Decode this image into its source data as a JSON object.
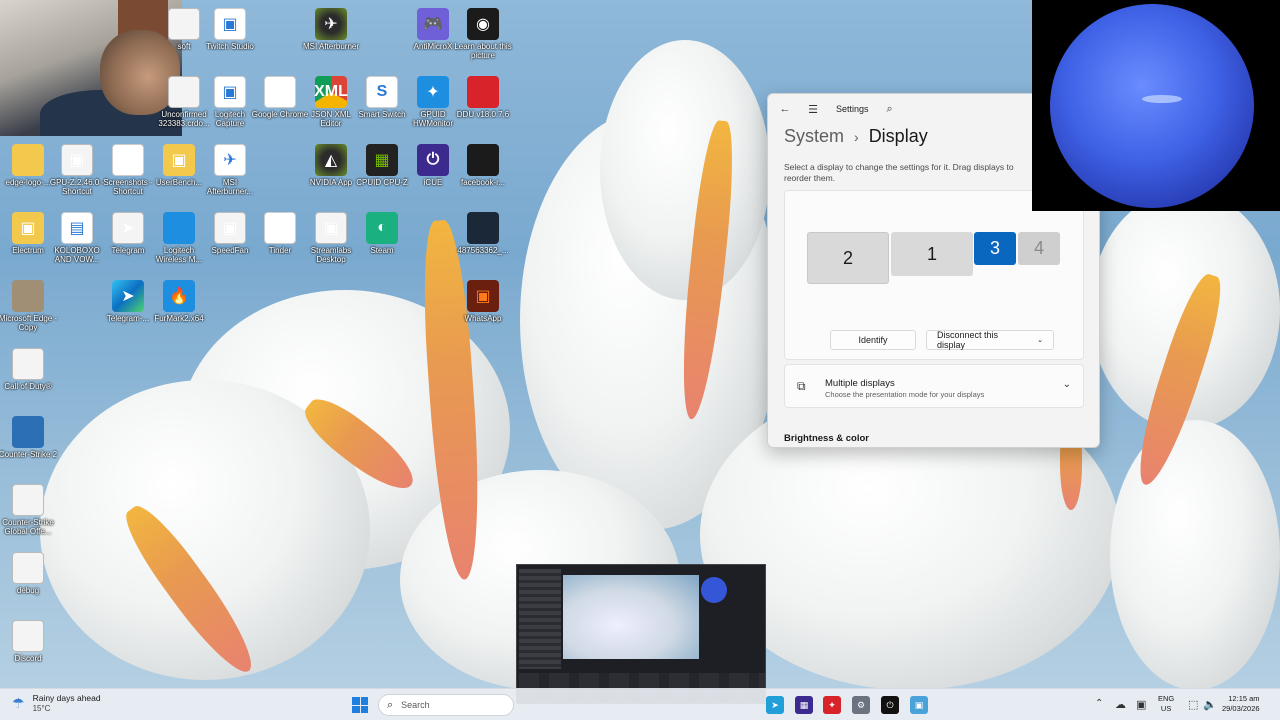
{
  "desktop_icons": [
    {
      "label": "soft",
      "glyph": "",
      "name": "icon-soft"
    },
    {
      "label": "Twitch Studio",
      "glyph": "▣",
      "name": "icon-twitch-studio"
    },
    {
      "label": "MSI Afterburner",
      "glyph": "✈",
      "name": "icon-msi-afterburner"
    },
    {
      "label": "AntiMicroX",
      "glyph": "🎮",
      "name": "icon-antimicrox"
    },
    {
      "label": "Learn about this picture",
      "glyph": "◉",
      "name": "icon-learn-about-picture"
    },
    {
      "label": "Unconfirmed 323383.crdo...",
      "glyph": "",
      "name": "icon-unconfirmed-download"
    },
    {
      "label": "Logitech Capture",
      "glyph": "▣",
      "name": "icon-logitech-capture"
    },
    {
      "label": "Google Chrome",
      "glyph": "",
      "name": "icon-google-chrome"
    },
    {
      "label": "JSON XML Editor",
      "glyph": "XML",
      "name": "icon-json-xml-editor"
    },
    {
      "label": "Smart Switch",
      "glyph": "S",
      "name": "icon-smart-switch"
    },
    {
      "label": "GPUID HWMonitor",
      "glyph": "✦",
      "name": "icon-hwmonitor"
    },
    {
      "label": "DDU v18.0.7.6",
      "glyph": "",
      "name": "icon-ddu"
    },
    {
      "label": "edge-logo-...",
      "glyph": "",
      "name": "icon-edge-logo"
    },
    {
      "label": "GPU-Z.2.46.0 - Shortcut",
      "glyph": "▣",
      "name": "icon-gpuz"
    },
    {
      "label": "Screenshots - Shortcut",
      "glyph": "",
      "name": "icon-screenshots"
    },
    {
      "label": "UserBench...",
      "glyph": "▣",
      "name": "icon-userbench"
    },
    {
      "label": "MSI Afterburner...",
      "glyph": "✈",
      "name": "icon-msi-afterburner-2"
    },
    {
      "label": "NVIDIA App",
      "glyph": "◭",
      "name": "icon-nvidia-app"
    },
    {
      "label": "CPUID CPU-Z",
      "glyph": "▦",
      "name": "icon-cpuz"
    },
    {
      "label": "iCUE",
      "glyph": "⏻",
      "name": "icon-icue"
    },
    {
      "label": "facebook-r...",
      "glyph": "",
      "name": "icon-facebook-folder"
    },
    {
      "label": "Electrum",
      "glyph": "▣",
      "name": "icon-electrum"
    },
    {
      "label": "KOLOBOXO AND VOW...",
      "glyph": "▤",
      "name": "icon-koloboxo"
    },
    {
      "label": "Telegram",
      "glyph": "➤",
      "name": "icon-telegram"
    },
    {
      "label": "Logitech Wireless M...",
      "glyph": "",
      "name": "icon-logitech-wireless"
    },
    {
      "label": "SpeedFan",
      "glyph": "▣",
      "name": "icon-speedfan"
    },
    {
      "label": "Tinder",
      "glyph": "",
      "name": "icon-tinder"
    },
    {
      "label": "Streamlabs Desktop",
      "glyph": "▣",
      "name": "icon-streamlabs"
    },
    {
      "label": "Steam",
      "glyph": "◐",
      "name": "icon-steam"
    },
    {
      "label": "487563362_...",
      "glyph": "",
      "name": "icon-image-file"
    },
    {
      "label": "Microsoft Edge - Copy",
      "glyph": "",
      "name": "icon-edge-copy"
    },
    {
      "label": "Telegram-...",
      "glyph": "➤",
      "name": "icon-telegram-2"
    },
    {
      "label": "FurMark2.x64",
      "glyph": "🔥",
      "name": "icon-furmark"
    },
    {
      "label": "WhatsApp",
      "glyph": "▣",
      "name": "icon-whatsapp"
    },
    {
      "label": "Call of Duty®",
      "glyph": "",
      "name": "icon-call-of-duty"
    },
    {
      "label": "Counter-Strike 2",
      "glyph": "",
      "name": "icon-cs2"
    },
    {
      "label": "Counter-Strike Global Offe...",
      "glyph": "",
      "name": "icon-csgo"
    },
    {
      "label": "debug",
      "glyph": "",
      "name": "icon-debug"
    },
    {
      "label": "Discord",
      "glyph": "",
      "name": "icon-discord"
    }
  ],
  "settings": {
    "app_title": "Settings",
    "breadcrumb_parent": "System",
    "breadcrumb_sep": "›",
    "breadcrumb_current": "Display",
    "hint": "Select a display to change the settings for it. Drag displays to reorder them.",
    "monitors": [
      "2",
      "1",
      "3",
      "4"
    ],
    "selected_monitor": "3",
    "identify_label": "Identify",
    "disconnect_label": "Disconnect this display",
    "multiple_displays_title": "Multiple displays",
    "multiple_displays_sub": "Choose the presentation mode for your displays",
    "brightness_heading": "Brightness & color"
  },
  "taskbar": {
    "weather_title": "Rainy days ahead",
    "weather_temp": "15°C",
    "search_placeholder": "Search",
    "lang_top": "ENG",
    "lang_bottom": "US",
    "time": "12:15 am",
    "date": "29/03/2026"
  },
  "colors": {
    "accent": "#0a67c0",
    "start_blue": "#1e7fe0"
  }
}
